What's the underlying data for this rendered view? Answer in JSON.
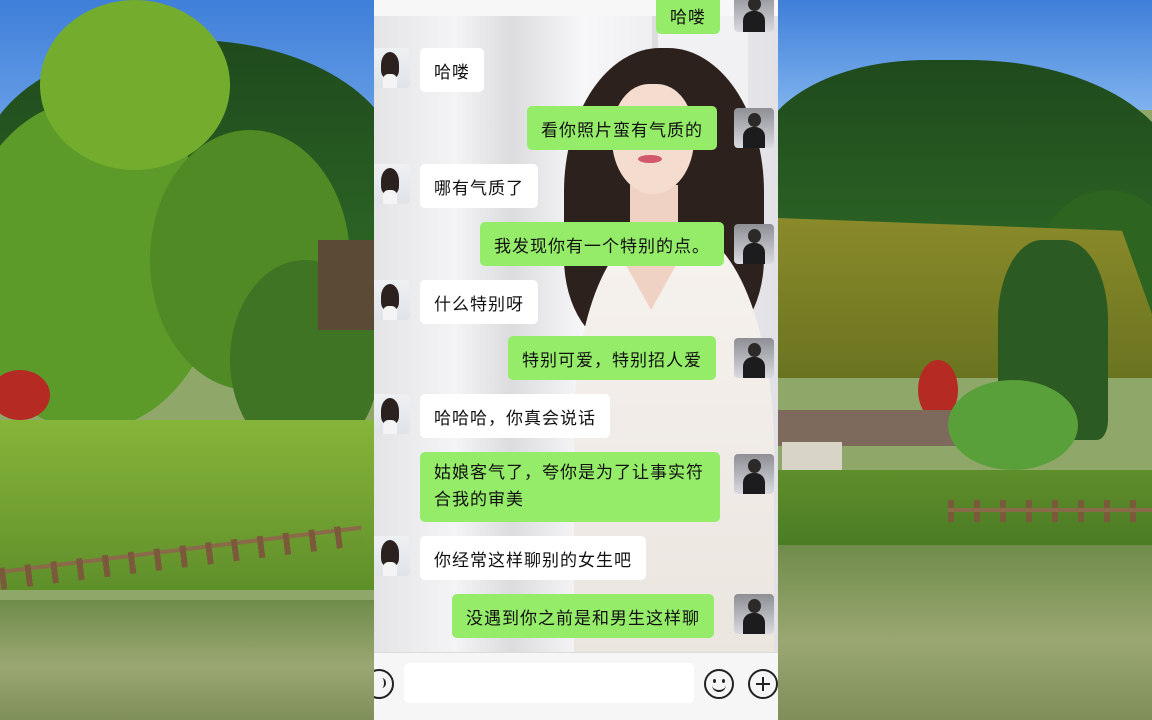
{
  "left_scene": {
    "description_icon": "landscape-forest-icon"
  },
  "right_scene": {
    "description_icon": "landscape-thatched-hut-icon"
  },
  "chat": {
    "messages": [
      {
        "side": "me",
        "text": "哈喽"
      },
      {
        "side": "her",
        "text": "哈喽"
      },
      {
        "side": "me",
        "text": "看你照片蛮有气质的"
      },
      {
        "side": "her",
        "text": "哪有气质了"
      },
      {
        "side": "me",
        "text": "我发现你有一个特别的点。"
      },
      {
        "side": "her",
        "text": "什么特别呀"
      },
      {
        "side": "me",
        "text": "特别可爱，特别招人爱"
      },
      {
        "side": "her",
        "text": "哈哈哈，你真会说话"
      },
      {
        "side": "me",
        "text": "姑娘客气了，夸你是为了让事实符合我的审美"
      },
      {
        "side": "her",
        "text": "你经常这样聊别的女生吧"
      },
      {
        "side": "me",
        "text": "没遇到你之前是和男生这样聊"
      }
    ],
    "input": {
      "value": "",
      "placeholder": ""
    }
  },
  "colors": {
    "sent_bubble": "#95ec69",
    "received_bubble": "#ffffff",
    "chat_background": "#ececec"
  },
  "icons": [
    "voice-icon",
    "emoji-icon",
    "plus-icon",
    "avatar-her-icon",
    "avatar-me-icon"
  ]
}
